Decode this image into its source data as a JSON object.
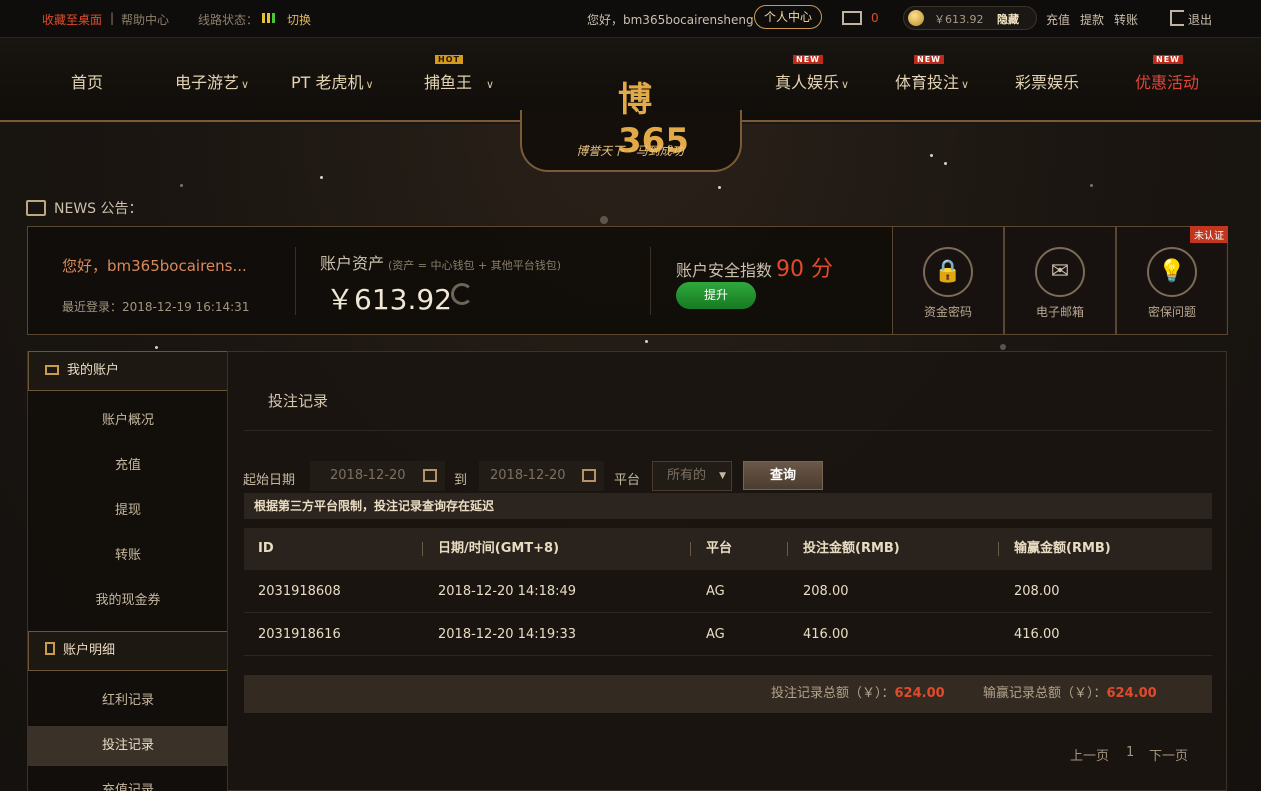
{
  "topbar": {
    "bookmark": "收藏至桌面",
    "help": "帮助中心",
    "line_status": "线路状态：",
    "switch": "切换",
    "greeting": "您好，bm365bocairensheng",
    "personal_center": "个人中心",
    "messages_count": "0",
    "balance": "￥613.92",
    "hide": "隐藏",
    "deposit": "充值",
    "withdraw": "提款",
    "transfer": "转账",
    "logout": "退出"
  },
  "nav": {
    "items": [
      {
        "label": "首页"
      },
      {
        "label": "电子游艺"
      },
      {
        "label": "PT 老虎机"
      },
      {
        "label": "捕鱼王",
        "tag": "HOT"
      },
      {
        "label": "真人娱乐",
        "tag": "NEW"
      },
      {
        "label": "体育投注",
        "tag": "NEW"
      },
      {
        "label": "彩票娱乐"
      },
      {
        "label": "优惠活动",
        "tag": "NEW"
      }
    ],
    "logo_text": "博365",
    "slogan": "博誉天下 · 马到成功"
  },
  "news": {
    "label": "NEWS 公告："
  },
  "account": {
    "greeting": "您好，bm365bocairens...",
    "last_login": "最近登录：2018-12-19 16:14:31",
    "assets_title": "账户资产",
    "assets_note": "(资产 = 中心钱包 + 其他平台钱包)",
    "assets_value": "￥613.92",
    "security_title": "账户安全指数",
    "security_score": "90 分",
    "upgrade": "提升",
    "security_items": [
      {
        "label": "资金密码",
        "icon": "lock-icon"
      },
      {
        "label": "电子邮箱",
        "icon": "mail-icon"
      },
      {
        "label": "密保问题",
        "icon": "lightbulb-icon"
      }
    ],
    "unverified": "未认证"
  },
  "sidebar": {
    "section1": "我的账户",
    "section1_items": [
      "账户概况",
      "充值",
      "提现",
      "转账",
      "我的现金券"
    ],
    "section2": "账户明细",
    "section2_items": [
      "红利记录",
      "投注记录",
      "充值记录"
    ]
  },
  "main": {
    "title": "投注记录",
    "start_label": "起始日期",
    "start_date": "2018-12-20",
    "to_label": "到",
    "end_date": "2018-12-20",
    "platform_label": "平台",
    "platform_value": "所有的",
    "query": "查询",
    "notice": "根据第三方平台限制，投注记录查询存在延迟",
    "columns": [
      "ID",
      "日期/时间(GMT+8)",
      "平台",
      "投注金额(RMB)",
      "输赢金额(RMB)"
    ],
    "rows": [
      [
        "2031918608",
        "2018-12-20 14:18:49",
        "AG",
        "208.00",
        "208.00"
      ],
      [
        "2031918616",
        "2018-12-20 14:19:33",
        "AG",
        "416.00",
        "416.00"
      ]
    ],
    "bet_total_label": "投注记录总额（￥）：",
    "bet_total": "624.00",
    "win_total_label": "输赢记录总额（￥）：",
    "win_total": "624.00",
    "prev": "上一页",
    "page": "1",
    "next": "下一页"
  }
}
